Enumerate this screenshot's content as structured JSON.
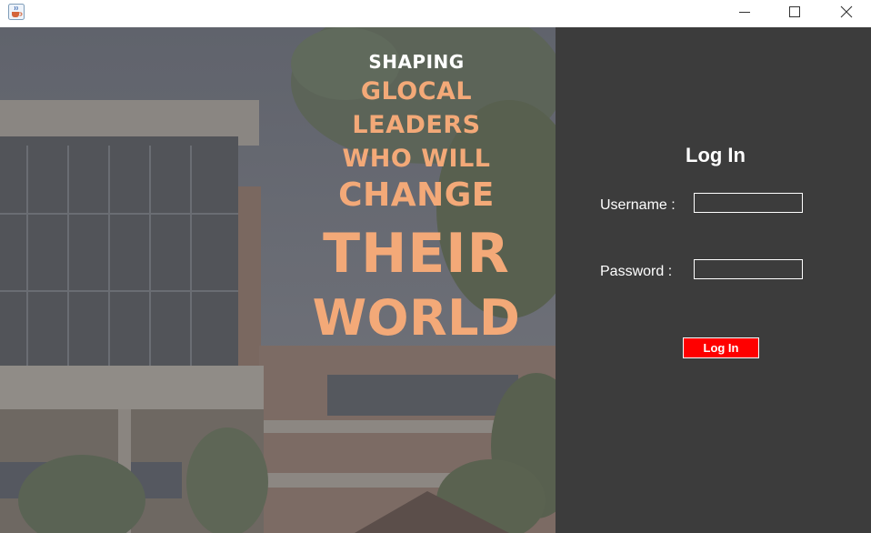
{
  "window": {
    "icon": "java-coffee-cup-icon",
    "controls": [
      "minimize-icon",
      "maximize-icon",
      "close-icon"
    ]
  },
  "hero": {
    "motto": [
      "SHAPING",
      "GLOCAL",
      "LEADERS",
      "WHO WILL",
      "CHANGE",
      "THEIR",
      "WORLD"
    ],
    "motto_color": "#f3a978",
    "first_line_color": "#ffffff"
  },
  "login": {
    "title": "Log In",
    "username_label": "Username :",
    "username_value": "",
    "password_label": "Password :",
    "password_value": "",
    "button_label": "Log In"
  },
  "colors": {
    "panel_bg": "#3c3c3c",
    "button_bg": "#ff0000",
    "text": "#ffffff"
  }
}
